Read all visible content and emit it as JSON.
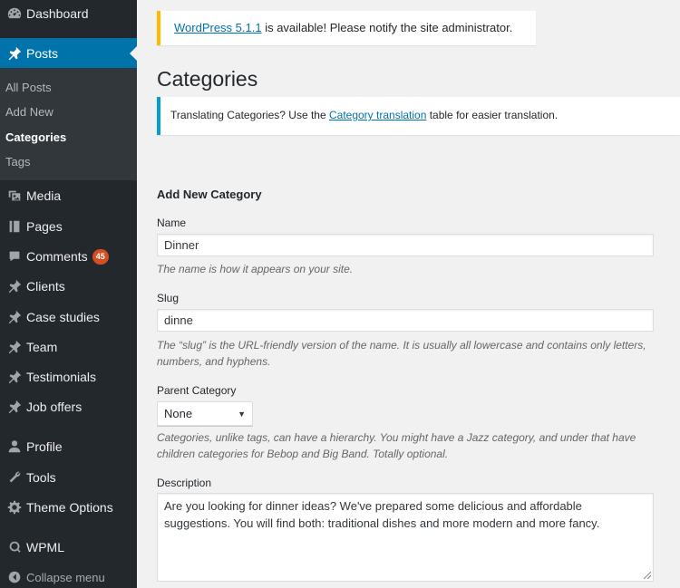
{
  "sidebar": {
    "dashboard": "Dashboard",
    "posts": "Posts",
    "posts_submenu": [
      "All Posts",
      "Add New",
      "Categories",
      "Tags"
    ],
    "media": "Media",
    "pages": "Pages",
    "comments": "Comments",
    "comments_badge": "45",
    "clients": "Clients",
    "case_studies": "Case studies",
    "team": "Team",
    "testimonials": "Testimonials",
    "job_offers": "Job offers",
    "profile": "Profile",
    "tools": "Tools",
    "theme_options": "Theme Options",
    "wpml": "WPML",
    "collapse": "Collapse menu"
  },
  "update_nag": {
    "link": "WordPress 5.1.1",
    "text": " is available! Please notify the site administrator."
  },
  "page_title": "Categories",
  "translation_notice": {
    "before": "Translating Categories? Use the ",
    "link": "Category translation",
    "after": " table for easier translation."
  },
  "form": {
    "section_title": "Add New Category",
    "name_label": "Name",
    "name_value": "Dinner",
    "name_help": "The name is how it appears on your site.",
    "slug_label": "Slug",
    "slug_value": "dinne",
    "slug_help": "The “slug” is the URL-friendly version of the name. It is usually all lowercase and contains only letters, numbers, and hyphens.",
    "parent_label": "Parent Category",
    "parent_value": "None",
    "parent_help": "Categories, unlike tags, can have a hierarchy. You might have a Jazz category, and under that have children categories for Bebop and Big Band. Totally optional.",
    "description_label": "Description",
    "description_value": "Are you looking for dinner ideas? We've prepared some delicious and affordable suggestions. You will find both: traditional dishes and more modern and more fancy."
  },
  "colors": {
    "sidebar_bg": "#23282d",
    "active_bg": "#0073aa",
    "link": "#0073aa",
    "nag_border": "#ffba00",
    "notice_border": "#00a0d2",
    "badge_bg": "#d54e21"
  }
}
